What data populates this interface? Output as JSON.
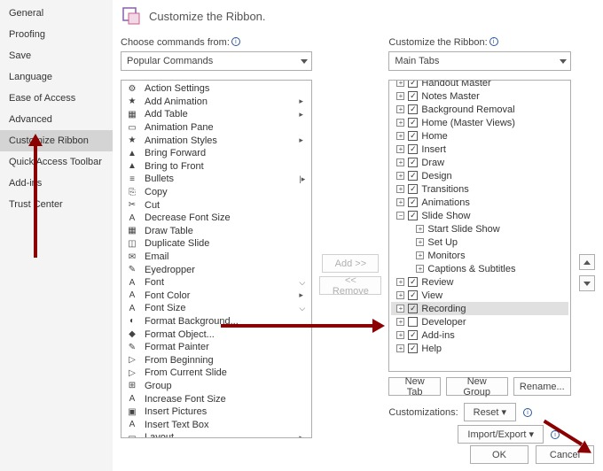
{
  "sidebar": {
    "items": [
      {
        "label": "General"
      },
      {
        "label": "Proofing"
      },
      {
        "label": "Save"
      },
      {
        "label": "Language"
      },
      {
        "label": "Ease of Access"
      },
      {
        "label": "Advanced"
      },
      {
        "label": "Customize Ribbon",
        "selected": true
      },
      {
        "label": "Quick Access Toolbar"
      },
      {
        "label": "Add-ins"
      },
      {
        "label": "Trust Center"
      }
    ]
  },
  "title": "Customize the Ribbon.",
  "left": {
    "label": "Choose commands from:",
    "dropdown": "Popular Commands",
    "commands": [
      {
        "icon": "⚙",
        "label": "Action Settings"
      },
      {
        "icon": "★",
        "label": "Add Animation",
        "sub": "▸"
      },
      {
        "icon": "▦",
        "label": "Add Table",
        "sub": "▸"
      },
      {
        "icon": "▭",
        "label": "Animation Pane"
      },
      {
        "icon": "★",
        "label": "Animation Styles",
        "sub": "▸"
      },
      {
        "icon": "▲",
        "label": "Bring Forward"
      },
      {
        "icon": "▲",
        "label": "Bring to Front"
      },
      {
        "icon": "≡",
        "label": "Bullets",
        "sub": "|▸"
      },
      {
        "icon": "⎘",
        "label": "Copy"
      },
      {
        "icon": "✂",
        "label": "Cut"
      },
      {
        "icon": "A",
        "label": "Decrease Font Size"
      },
      {
        "icon": "▦",
        "label": "Draw Table"
      },
      {
        "icon": "◫",
        "label": "Duplicate Slide"
      },
      {
        "icon": "✉",
        "label": "Email"
      },
      {
        "icon": "✎",
        "label": "Eyedropper"
      },
      {
        "icon": "A",
        "label": "Font",
        "sub": "⌵"
      },
      {
        "icon": "A",
        "label": "Font Color",
        "sub": "▸"
      },
      {
        "icon": "A",
        "label": "Font Size",
        "sub": "⌵"
      },
      {
        "icon": "◐",
        "label": "Format Background..."
      },
      {
        "icon": "◆",
        "label": "Format Object..."
      },
      {
        "icon": "✎",
        "label": "Format Painter"
      },
      {
        "icon": "▷",
        "label": "From Beginning"
      },
      {
        "icon": "▷",
        "label": "From Current Slide"
      },
      {
        "icon": "⊞",
        "label": "Group"
      },
      {
        "icon": "A",
        "label": "Increase Font Size"
      },
      {
        "icon": "▣",
        "label": "Insert Pictures"
      },
      {
        "icon": "A",
        "label": "Insert Text Box"
      },
      {
        "icon": "▭",
        "label": "Layout",
        "sub": "▸"
      }
    ]
  },
  "mid": {
    "add": "Add >>",
    "remove": "<< Remove"
  },
  "right": {
    "label": "Customize the Ribbon:",
    "dropdown": "Main Tabs",
    "tree": [
      {
        "indent": 0,
        "plus": "+",
        "chk": true,
        "label": "Handout Master",
        "clip": true
      },
      {
        "indent": 0,
        "plus": "+",
        "chk": true,
        "label": "Notes Master"
      },
      {
        "indent": 0,
        "plus": "+",
        "chk": true,
        "label": "Background Removal"
      },
      {
        "indent": 0,
        "plus": "+",
        "chk": true,
        "label": "Home (Master Views)"
      },
      {
        "indent": 0,
        "plus": "+",
        "chk": true,
        "label": "Home"
      },
      {
        "indent": 0,
        "plus": "+",
        "chk": true,
        "label": "Insert"
      },
      {
        "indent": 0,
        "plus": "+",
        "chk": true,
        "label": "Draw"
      },
      {
        "indent": 0,
        "plus": "+",
        "chk": true,
        "label": "Design"
      },
      {
        "indent": 0,
        "plus": "+",
        "chk": true,
        "label": "Transitions"
      },
      {
        "indent": 0,
        "plus": "+",
        "chk": true,
        "label": "Animations"
      },
      {
        "indent": 0,
        "plus": "−",
        "chk": true,
        "label": "Slide Show"
      },
      {
        "indent": 1,
        "plus": "+",
        "label": "Start Slide Show"
      },
      {
        "indent": 1,
        "plus": "+",
        "label": "Set Up"
      },
      {
        "indent": 1,
        "plus": "+",
        "label": "Monitors"
      },
      {
        "indent": 1,
        "plus": "+",
        "label": "Captions & Subtitles"
      },
      {
        "indent": 0,
        "plus": "+",
        "chk": true,
        "label": "Review"
      },
      {
        "indent": 0,
        "plus": "+",
        "chk": true,
        "label": "View"
      },
      {
        "indent": 0,
        "plus": "+",
        "chk": true,
        "label": "Recording",
        "highlight": true
      },
      {
        "indent": 0,
        "plus": "+",
        "chk": false,
        "label": "Developer"
      },
      {
        "indent": 0,
        "plus": "+",
        "chk": true,
        "label": "Add-ins"
      },
      {
        "indent": 0,
        "plus": "+",
        "chk": true,
        "label": "Help",
        "clip": true
      }
    ],
    "buttons": {
      "newtab": "New Tab",
      "newgroup": "New Group",
      "rename": "Rename..."
    },
    "custLabel": "Customizations:",
    "reset": "Reset",
    "importExport": "Import/Export"
  },
  "footer": {
    "ok": "OK",
    "cancel": "Cancel"
  }
}
